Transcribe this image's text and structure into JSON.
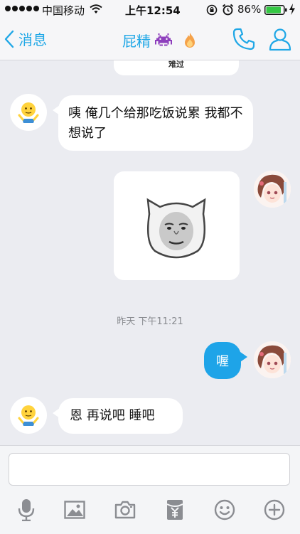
{
  "status_bar": {
    "carrier": "中国移动",
    "time": "上午12:54",
    "battery": "86%"
  },
  "nav": {
    "back_label": "消息",
    "title": "屁精"
  },
  "top_sticker_caption": "难过",
  "messages": [
    {
      "text": "咦 俺几个给那吃饭说累 我都不想说了"
    },
    {
      "text": "喔"
    },
    {
      "text": "恩 再说吧 睡吧"
    }
  ],
  "timestamp": "昨天 下午11:21",
  "colors": {
    "accent": "#1fa7e6",
    "outgoing_bubble": "#1ea4e8",
    "background": "#ebecf1"
  }
}
